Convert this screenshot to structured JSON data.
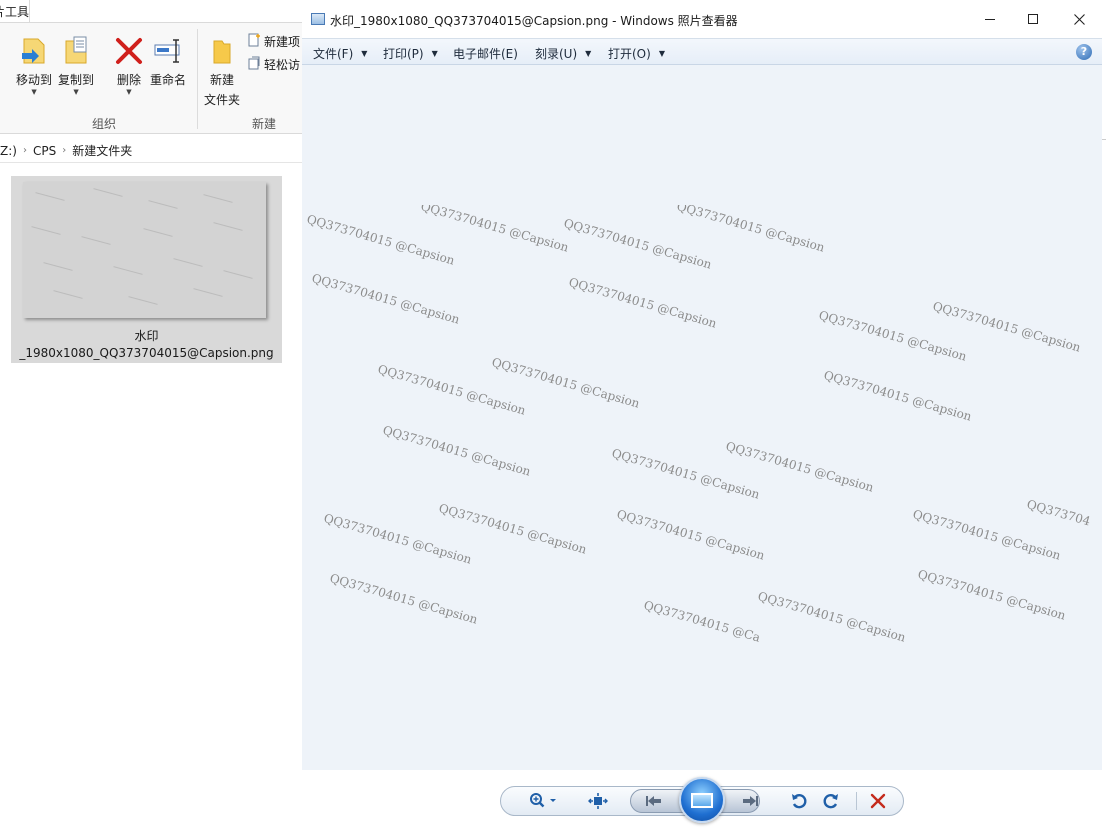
{
  "explorer": {
    "tool_tab": "片工具",
    "ribbon": {
      "move_to": "移动到",
      "copy_to": "复制到",
      "delete": "删除",
      "rename": "重命名",
      "new_folder_line1": "新建",
      "new_folder_line2": "文件夹",
      "new_item": "新建项",
      "easy_access": "轻松访",
      "group_organize": "组织",
      "group_new": "新建"
    },
    "address": {
      "drive": "Z:)",
      "crumb1": "CPS",
      "crumb2": "新建文件夹"
    },
    "file": {
      "name_line1": "水印",
      "name_line2": "_1980x1080_QQ373704015@Capsion.png"
    }
  },
  "viewer": {
    "title": "水印_1980x1080_QQ373704015@Capsion.png - Windows 照片查看器",
    "menu": {
      "file": "文件(F)",
      "print": "打印(P)",
      "email": "电子邮件(E)",
      "burn": "刻录(U)",
      "open": "打开(O)"
    },
    "help_glyph": "?",
    "watermark_text": "QQ373704015 @Capsion",
    "watermark_clipped_1": "QQ373704015 @Ca",
    "watermark_clipped_2": "QQ373704015 @Capsion",
    "watermark_clipped_3": "QQ373704",
    "colors": {
      "canvas_bg": "#eef3f9",
      "watermark": "#8c8c8c",
      "delete_red": "#c42b1c",
      "accent_blue": "#1f6fd1"
    },
    "controls": [
      "zoom-icon",
      "fit-window-icon",
      "previous-icon",
      "slideshow-icon",
      "next-icon",
      "rotate-ccw-icon",
      "rotate-cw-icon",
      "delete-icon"
    ]
  }
}
